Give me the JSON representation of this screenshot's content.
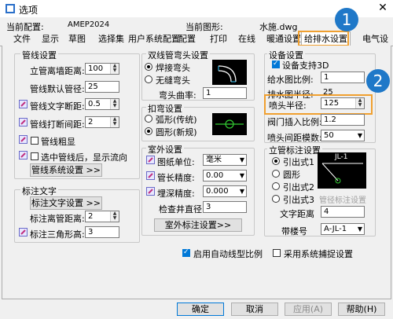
{
  "window": {
    "title": "选项",
    "close_glyph": "✕"
  },
  "header": {
    "current_profile_label": "当前配置:",
    "current_profile_value": "AMEP2024",
    "current_drawing_label": "当前图形:",
    "current_drawing_value": "水施.dwg"
  },
  "tabs": [
    "文件",
    "显示",
    "草图",
    "选择集",
    "用户系统配置",
    "配置",
    "打印",
    "在线",
    "暖通设置",
    "给排水设置",
    "电气设"
  ],
  "active_tab": "给排水设置",
  "pipe": {
    "title": "管线设置",
    "height_label": "立管离墙距离:",
    "height_value": "100",
    "default_diam_label": "管线默认管径:",
    "default_diam_value": "25",
    "text_break_label": "管线文字断距:",
    "text_break_value": "0.5",
    "break_gap_label": "管线打断间距:",
    "break_gap_value": "2",
    "bold_label": "管线粗显",
    "flow_label": "选中管线后，显示流向",
    "system_btn": "管线系统设置 >>"
  },
  "annot": {
    "title": "标注文字",
    "settings_btn": "标注文字设置 >>",
    "dist_label": "标注离管距离:",
    "dist_value": "2",
    "tri_label": "标注三角形高:",
    "tri_value": "3"
  },
  "elbow": {
    "title": "双线管弯头设置",
    "weld_label": "焊接弯头",
    "seamless_label": "无缝弯头",
    "radius_label": "弯头曲率:",
    "radius_value": "1"
  },
  "buckle": {
    "title": "扣弯设置",
    "arc_label": "弧形(传统)",
    "circle_label": "圆形(新规)"
  },
  "outdoor": {
    "title": "室外设置",
    "unit_label": "图纸单位:",
    "unit_value": "毫米",
    "len_label": "管长精度:",
    "len_value": "0.00",
    "depth_label": "埋深精度:",
    "depth_value": "0.000",
    "well_label": "检查井直径:",
    "well_value": "3",
    "btn": "室外标注设置>>"
  },
  "device": {
    "title": "设备设置",
    "support3d_label": "设备支持3D",
    "supply_label": "给水图比例:",
    "supply_value": "1",
    "drain_label": "排水图半径:",
    "drain_value": "25",
    "nozzle_label": "喷头半径:",
    "nozzle_value": "125",
    "valve_label": "阀门插入比例:",
    "valve_value": "1.2",
    "spray_label": "喷头间距模数:",
    "spray_value": "50"
  },
  "riser": {
    "title": "立管标注设置",
    "opt1": "引出式1",
    "opt2": "圆形",
    "opt3": "引出式2",
    "opt4": "引出式3",
    "preview_label": "JL-1",
    "style_label": "管径标注设置",
    "text_dist_label": "文字距离",
    "text_dist_value": "4",
    "prefix_label": "带楼号",
    "prefix_value": "A-JL-1"
  },
  "bottom_checks": {
    "auto_scale": "启用自动线型比例",
    "sys_snap": "采用系统捕捉设置"
  },
  "buttons": {
    "ok": "确定",
    "cancel": "取消",
    "apply": "应用(A)",
    "help": "帮助(H)"
  },
  "callouts": {
    "one": "1",
    "two": "2"
  },
  "colors": {
    "accent": "#0078d7",
    "callout": "#1f78c8",
    "highlight": "#f0a030"
  }
}
